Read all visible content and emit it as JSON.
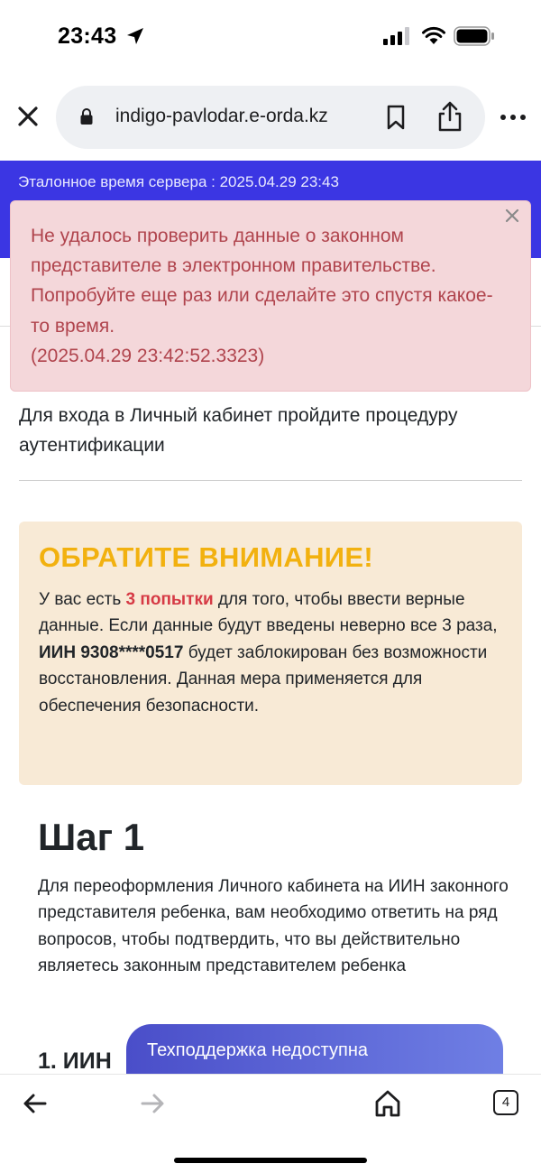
{
  "status_bar": {
    "time": "23:43",
    "icons": [
      "location-arrow-icon",
      "cellular-signal-icon",
      "wifi-icon",
      "battery-icon"
    ]
  },
  "browser": {
    "url": "indigo-pavlodar.e-orda.kz",
    "icons": [
      "close-icon",
      "lock-icon",
      "bookmark-icon",
      "share-icon",
      "more-icon"
    ]
  },
  "header": {
    "server_time": "Эталонное время сервера : 2025.04.29 23:43",
    "accent_color": "#3b36e3"
  },
  "error_alert": {
    "message": "Не удалось проверить данные о законном представителе в электронном правительстве. Попробуйте еще раз или сделайте это спустя какое-то время.",
    "timestamp": "(2025.04.29 23:42:52.3323)",
    "close_symbol": "×"
  },
  "intro": {
    "text": "Для входа в Личный кабинет пройдите процедуру аутентификации"
  },
  "warning": {
    "title": "ОБРАТИТЕ ВНИМАНИЕ!",
    "part1": "У вас есть ",
    "attempts": "3 попытки",
    "part2": " для того, чтобы ввести верные данные. Если данные будут введены неверно все 3 раза, ",
    "iin": "ИИН 9308****0517",
    "part3": " будет заблокирован без возможности восстановления. Данная мера применяется для обеспечения безопасности."
  },
  "step": {
    "title": "Шаг 1",
    "description": "Для переоформления Личного кабинета на ИИН законного представителя ребенка, вам необходимо ответить на ряд вопросов, чтобы подтвердить, что вы действительно являетесь законным представителем ребенка",
    "question_heading": "1. ИИН"
  },
  "support": {
    "label": "Техподдержка недоступна"
  },
  "toolbar": {
    "tab_count": "4",
    "icons": [
      "back-arrow-icon",
      "forward-arrow-icon",
      "home-icon",
      "tabs-icon"
    ]
  }
}
